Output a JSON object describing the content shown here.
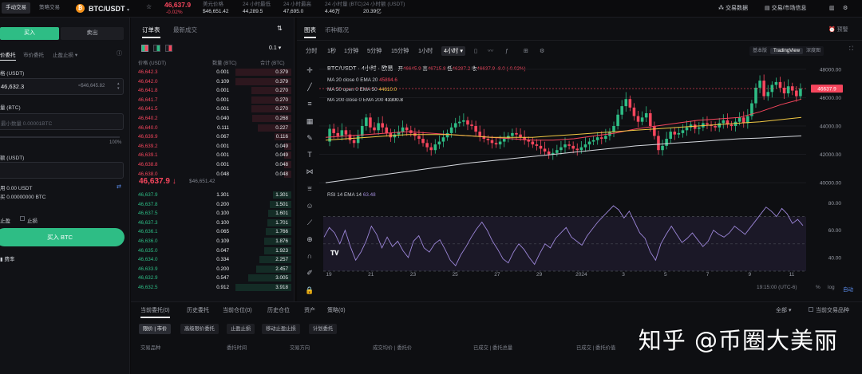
{
  "topbar": {
    "mode_manual": "手动交易",
    "mode_strategy": "策略交易",
    "pair": "BTC/USDT",
    "price": "46,637.9",
    "change": "-0.02%",
    "stats": [
      {
        "label": "美元价格",
        "value": "$46,651.42"
      },
      {
        "label": "24 小时最低",
        "value": "44,289.5"
      },
      {
        "label": "24 小时最高",
        "value": "47,695.0"
      },
      {
        "label": "24 小时量 (BTC)",
        "value": "4.46万"
      },
      {
        "label": "24 小时额 (USDT)",
        "value": "20.39亿"
      }
    ],
    "trading_data": "交易数据",
    "market_info": "交易/市场信息"
  },
  "order_form": {
    "tab_buy": "买入",
    "tab_sell": "卖出",
    "order_types": [
      "价委托",
      "市价委托",
      "止盈止损"
    ],
    "price_label": "格 (USDT)",
    "price_value": "46,632.3",
    "price_usd": "≈$46,645.82",
    "amount_label": "量 (BTC)",
    "amount_placeholder": "最小数量 0.00001BTC",
    "slider_max": "100%",
    "total_label": "额 (USDT)",
    "available_usdt": "用 0.00 USDT",
    "available_btc": "买 0.00000000 BTC",
    "take_profit": "止盈",
    "stop_loss": "止损",
    "buy_button": "买入 BTC",
    "fee_rate": "费率"
  },
  "orderbook": {
    "tab_book": "订单表",
    "tab_trades": "最新成交",
    "precision": "0.1",
    "col_price": "价格 (USDT)",
    "col_amount": "数量 (BTC)",
    "col_total": "合计 (BTC)",
    "asks": [
      {
        "price": "46,642.3",
        "amount": "0.001",
        "total": "0.379"
      },
      {
        "price": "46,642.0",
        "amount": "0.109",
        "total": "0.379"
      },
      {
        "price": "46,641.8",
        "amount": "0.001",
        "total": "0.270"
      },
      {
        "price": "46,641.7",
        "amount": "0.001",
        "total": "0.270"
      },
      {
        "price": "46,641.5",
        "amount": "0.001",
        "total": "0.270"
      },
      {
        "price": "46,640.2",
        "amount": "0.040",
        "total": "0.268"
      },
      {
        "price": "46,640.0",
        "amount": "0.111",
        "total": "0.227"
      },
      {
        "price": "46,639.9",
        "amount": "0.067",
        "total": "0.116"
      },
      {
        "price": "46,639.2",
        "amount": "0.001",
        "total": "0.049"
      },
      {
        "price": "46,639.1",
        "amount": "0.001",
        "total": "0.049"
      },
      {
        "price": "46,638.8",
        "amount": "0.001",
        "total": "0.048"
      },
      {
        "price": "46,638.0",
        "amount": "0.048",
        "total": "0.048"
      }
    ],
    "mid_price": "46,637.9 ↓",
    "mid_usd": "$46,651.42",
    "bids": [
      {
        "price": "46,637.9",
        "amount": "1.301",
        "total": "1.301"
      },
      {
        "price": "46,637.8",
        "amount": "0.200",
        "total": "1.501"
      },
      {
        "price": "46,637.5",
        "amount": "0.100",
        "total": "1.601"
      },
      {
        "price": "46,637.3",
        "amount": "0.100",
        "total": "1.701"
      },
      {
        "price": "46,636.1",
        "amount": "0.065",
        "total": "1.766"
      },
      {
        "price": "46,636.0",
        "amount": "0.109",
        "total": "1.876"
      },
      {
        "price": "46,635.0",
        "amount": "0.047",
        "total": "1.923"
      },
      {
        "price": "46,634.0",
        "amount": "0.334",
        "total": "2.257"
      },
      {
        "price": "46,633.9",
        "amount": "0.200",
        "total": "2.457"
      },
      {
        "price": "46,632.9",
        "amount": "0.547",
        "total": "3.005"
      },
      {
        "price": "46,632.5",
        "amount": "0.912",
        "total": "3.918"
      }
    ]
  },
  "chart_panel": {
    "tab_chart": "图表",
    "tab_overview": "币种概况",
    "tab_alert": "预警",
    "timeframes": [
      "分时",
      "1秒",
      "1分钟",
      "5分钟",
      "15分钟",
      "1小时",
      "4小时"
    ],
    "active_timeframe": "4小时",
    "view_basic": "基本版",
    "view_tradingview": "TradingView",
    "view_depth": "深度图",
    "title": "BTC/USDT · 4小时 · 欧易",
    "ohlc": {
      "o_label": "开",
      "o": "46645.9",
      "h_label": "高",
      "h": "46715.8",
      "l_label": "低",
      "l": "46287.2",
      "c_label": "收",
      "c": "46637.9",
      "chg": "-8.0 (-0.02%)"
    },
    "ma_lines": [
      {
        "label": "MA 20 close 0 EMA 20",
        "value": "45894.6"
      },
      {
        "label": "MA 50 open 0 EMA 50",
        "value": "44610.0"
      },
      {
        "label": "MA 200 close 0 EMA 200",
        "value": "43300.8"
      }
    ],
    "rsi_label": "RSI 14 EMA 14",
    "rsi_value": "63.48",
    "time_display": "19:15:00 (UTC-6)",
    "pct": "%",
    "log": "log",
    "auto": "自动"
  },
  "chart_data": [
    {
      "type": "line",
      "title": "BTC/USDT · 4小时 · 欧易",
      "x": [
        "19",
        "21",
        "23",
        "25",
        "27",
        "29",
        "2024",
        "3",
        "5",
        "7",
        "9",
        "11"
      ],
      "y_ticks": [
        40000,
        42000,
        44000,
        46000,
        48000
      ],
      "ylim": [
        39500,
        48500
      ],
      "last_price": "46637.9",
      "series": [
        {
          "name": "close",
          "values": [
            42900,
            43800,
            43500,
            43300,
            43700,
            43400,
            43000,
            42800,
            43300,
            44000,
            44600,
            43900,
            43700,
            44200,
            43900,
            43500,
            43200,
            43400,
            43600,
            43900,
            43700,
            43500,
            43300,
            43100,
            42800,
            42500,
            42300,
            42700,
            42900,
            43200,
            43500,
            43900,
            44200,
            44300,
            44400,
            44100,
            44000,
            43600,
            43300,
            43100,
            43000,
            42800,
            42700,
            42900,
            43100,
            43300,
            43500,
            43400,
            43200,
            43000,
            42900,
            42700,
            42600,
            42400,
            42200,
            42000,
            42100,
            42300,
            42500,
            42700,
            42600,
            42400,
            42300,
            42500,
            42700,
            42900,
            43000,
            43200,
            43100,
            43300,
            43600,
            44000,
            44800,
            45400,
            45900,
            45300,
            44700,
            44300,
            44600,
            44900,
            44000,
            43300,
            42300,
            42600,
            43100,
            43600,
            43400,
            43500,
            43700,
            43900,
            44100,
            43800,
            43900,
            44200,
            44100,
            44000,
            43900,
            44200,
            44400,
            44100,
            44000,
            44300,
            44600,
            44200,
            44700,
            45600,
            46700,
            47200,
            46100,
            46400,
            46900,
            47100,
            46700,
            46300,
            46800,
            46500,
            46100,
            46637.9
          ]
        },
        {
          "name": "MA 20",
          "values": [
            43200,
            43300,
            43400,
            43500,
            43600,
            43500,
            43400,
            43300,
            43200,
            43100,
            43000,
            43000,
            43100,
            43300,
            43500,
            43800,
            44000,
            44200,
            44400,
            44500,
            44600,
            45000,
            45500,
            45894.6
          ]
        },
        {
          "name": "MA 50",
          "values": [
            43000,
            43100,
            43200,
            43300,
            43400,
            43400,
            43400,
            43300,
            43200,
            43200,
            43200,
            43300,
            43400,
            43500,
            43600,
            43700,
            43800,
            43900,
            44000,
            44100,
            44200,
            44300,
            44450,
            44610.0
          ]
        },
        {
          "name": "MA 200",
          "values": [
            40000,
            40200,
            40400,
            40600,
            40800,
            41000,
            41200,
            41400,
            41550,
            41700,
            41850,
            42000,
            42150,
            42300,
            42450,
            42600,
            42700,
            42800,
            42900,
            43000,
            43100,
            43150,
            43230,
            43300.8
          ]
        }
      ]
    },
    {
      "type": "line",
      "title": "RSI 14 EMA 14",
      "y_ticks": [
        40,
        60,
        80
      ],
      "ylim": [
        30,
        85
      ],
      "series": [
        {
          "name": "RSI",
          "values": [
            55,
            62,
            58,
            50,
            60,
            48,
            38,
            44,
            52,
            63,
            57,
            47,
            55,
            48,
            52,
            45,
            40,
            52,
            56,
            47,
            44,
            50,
            53,
            46,
            38,
            34,
            42,
            48,
            55,
            61,
            66,
            60,
            52,
            46,
            39,
            36,
            44,
            50,
            46,
            40,
            35,
            43,
            50,
            47,
            54,
            58,
            62,
            55,
            52,
            49,
            56,
            61,
            66,
            70,
            74,
            78,
            75,
            69,
            74,
            66,
            58,
            54,
            44,
            38,
            50,
            57,
            63,
            57,
            51,
            54,
            58,
            53,
            48,
            52,
            60,
            57,
            55,
            58,
            63,
            60,
            57,
            62,
            67,
            72,
            77,
            74,
            70,
            76,
            72,
            65,
            68,
            63.48
          ]
        }
      ]
    }
  ],
  "bottom": {
    "tabs": [
      "当前委托(0)",
      "历史委托",
      "当前仓位(0)",
      "历史仓位",
      "资产",
      "策略(0)"
    ],
    "all": "全部",
    "current_only": "当前交易品种",
    "subtabs": [
      "限价 | 市价",
      "高级限价委托",
      "止盈止损",
      "移动止盈止损",
      "计划委托"
    ],
    "columns": [
      "交易品种",
      "委托时间",
      "交易方向",
      "成交均价 | 委托价",
      "已成交 | 委托总量",
      "已成交 | 委托价值"
    ]
  },
  "watermark": "知乎 @币圈大美丽"
}
